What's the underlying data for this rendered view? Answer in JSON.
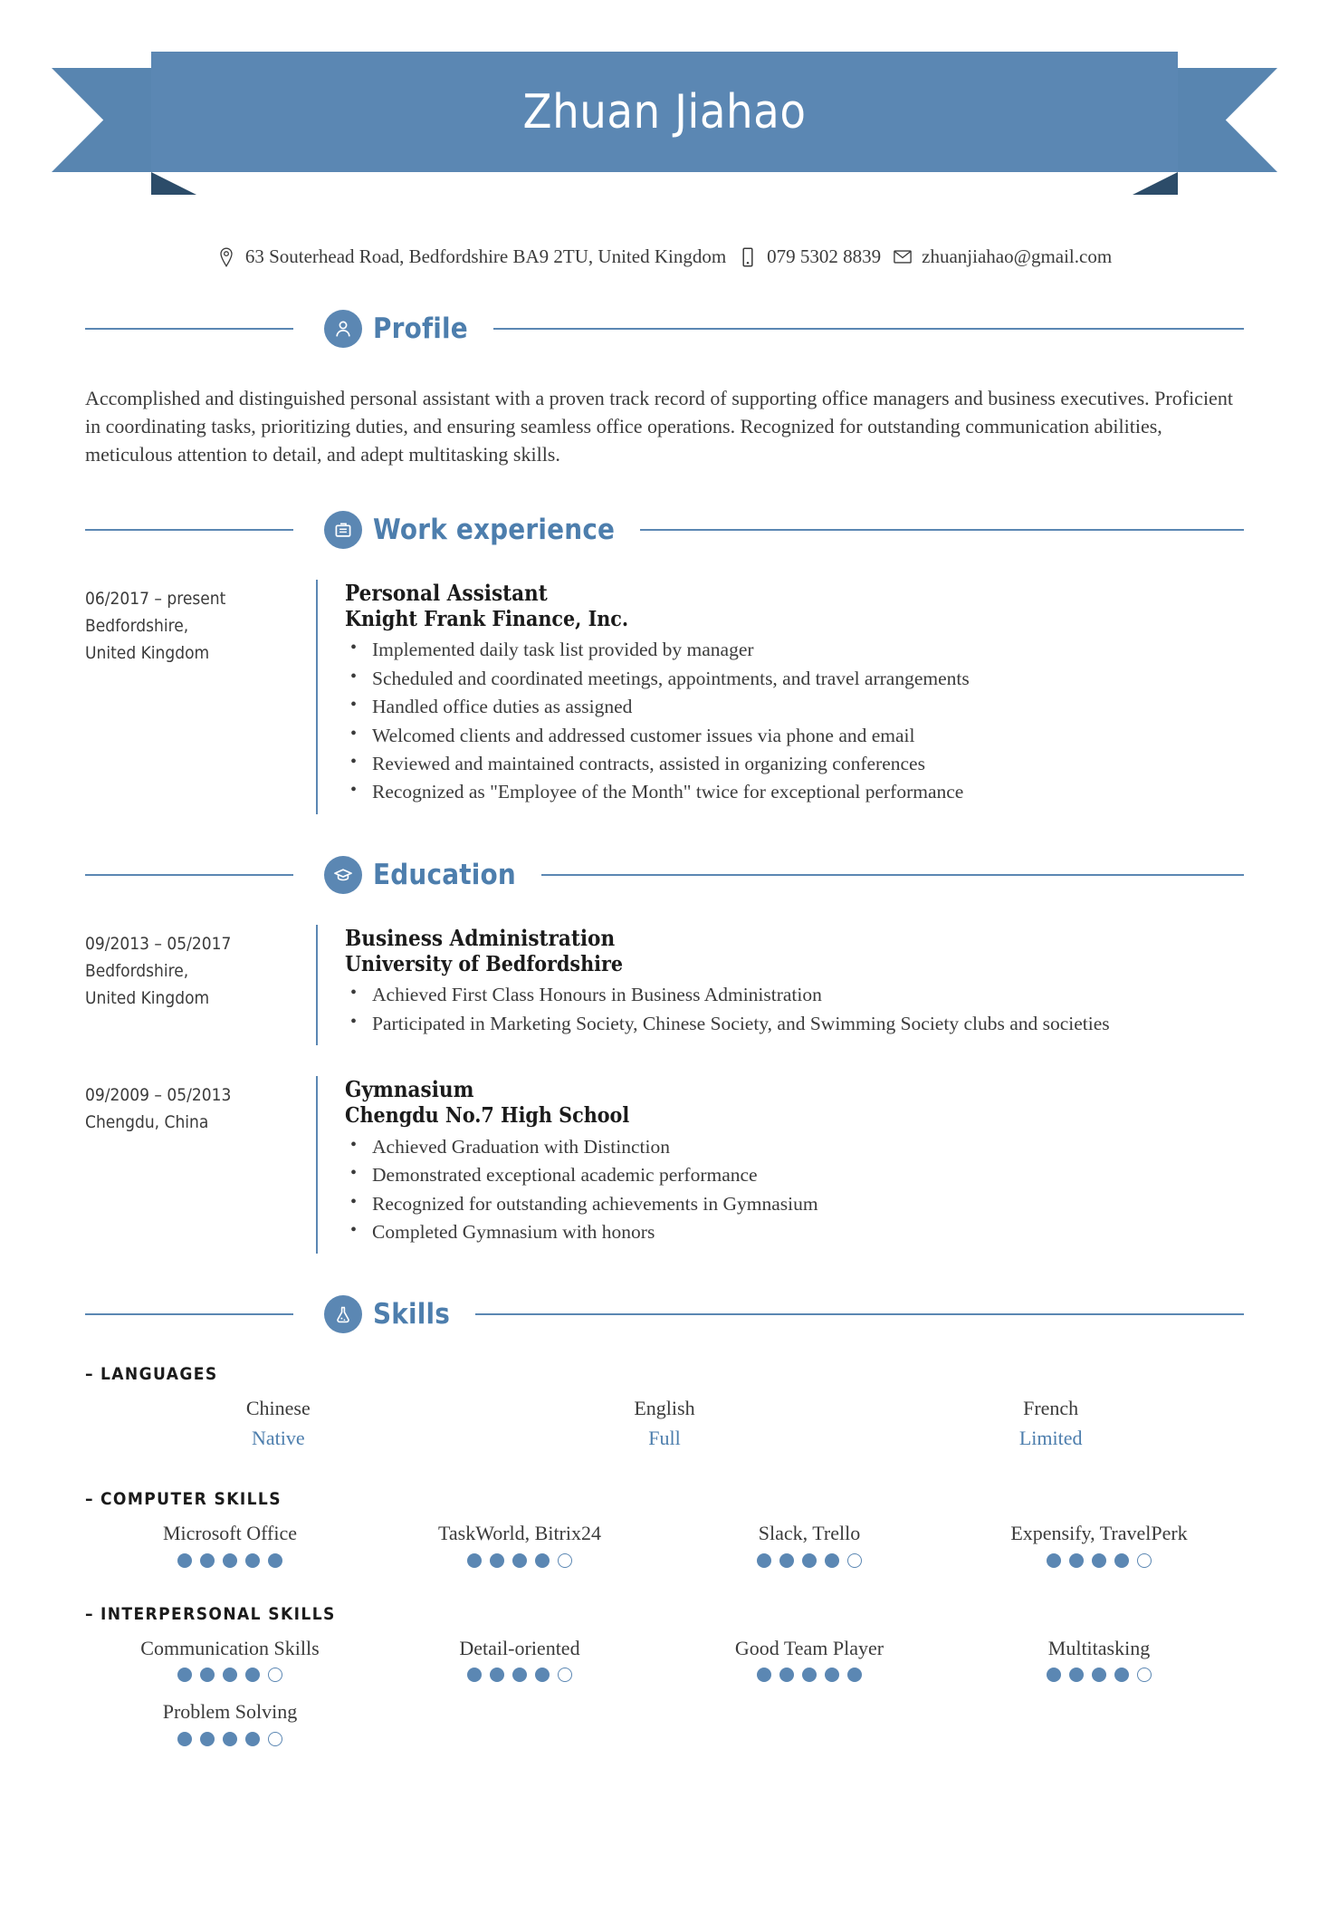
{
  "header": {
    "name": "Zhuan Jiahao",
    "accent_color": "#5b87b3",
    "ribbon_shadow_color": "#2c4c69"
  },
  "contact": {
    "address": "63 Souterhead Road, Bedfordshire BA9 2TU, United Kingdom",
    "address_icon": "location-pin-icon",
    "phone": "079 5302 8839",
    "phone_icon": "mobile-phone-icon",
    "email": "zhuanjiahao@gmail.com",
    "email_icon": "envelope-icon"
  },
  "sections": {
    "profile": {
      "title": "Profile",
      "icon": "person-icon",
      "text": "Accomplished and distinguished personal assistant with a proven track record of supporting office managers and business executives. Proficient in coordinating tasks, prioritizing duties, and ensuring seamless office operations. Recognized for outstanding communication abilities, meticulous attention to detail, and adept multitasking skills."
    },
    "work": {
      "title": "Work experience",
      "icon": "briefcase-icon",
      "entries": [
        {
          "dates": "06/2017 – present",
          "location_line1": "Bedfordshire,",
          "location_line2": "United Kingdom",
          "role": "Personal Assistant",
          "organization": "Knight Frank Finance, Inc.",
          "bullets": [
            "Implemented daily task list provided by manager",
            "Scheduled and coordinated meetings, appointments, and travel arrangements",
            "Handled office duties as assigned",
            "Welcomed clients and addressed customer issues via phone and email",
            "Reviewed and maintained contracts, assisted in organizing conferences",
            "Recognized as \"Employee of the Month\" twice for exceptional performance"
          ]
        }
      ]
    },
    "education": {
      "title": "Education",
      "icon": "graduation-cap-icon",
      "entries": [
        {
          "dates": "09/2013 – 05/2017",
          "location_line1": "Bedfordshire,",
          "location_line2": "United Kingdom",
          "role": "Business Administration",
          "organization": "University of Bedfordshire",
          "bullets": [
            "Achieved First Class Honours in Business Administration",
            "Participated in Marketing Society, Chinese Society, and Swimming Society clubs and societies"
          ]
        },
        {
          "dates": "09/2009 – 05/2013",
          "location_line1": "Chengdu, China",
          "location_line2": "",
          "role": "Gymnasium",
          "organization": "Chengdu No.7 High School",
          "bullets": [
            "Achieved Graduation with Distinction",
            "Demonstrated exceptional academic performance",
            "Recognized for outstanding achievements in Gymnasium",
            "Completed Gymnasium with honors"
          ]
        }
      ]
    },
    "skills": {
      "title": "Skills",
      "icon": "flask-icon",
      "groups": [
        {
          "label": "LANGUAGES",
          "columns": 3,
          "items": [
            {
              "name": "Chinese",
              "level": "Native"
            },
            {
              "name": "English",
              "level": "Full"
            },
            {
              "name": "French",
              "level": "Limited"
            }
          ]
        },
        {
          "label": "COMPUTER SKILLS",
          "columns": 4,
          "items": [
            {
              "name": "Microsoft Office",
              "rating": 5,
              "max": 5
            },
            {
              "name": "TaskWorld, Bitrix24",
              "rating": 4,
              "max": 5
            },
            {
              "name": "Slack, Trello",
              "rating": 4,
              "max": 5
            },
            {
              "name": "Expensify, TravelPerk",
              "rating": 4,
              "max": 5
            }
          ]
        },
        {
          "label": "INTERPERSONAL SKILLS",
          "columns": 4,
          "items": [
            {
              "name": "Communication Skills",
              "rating": 4,
              "max": 5
            },
            {
              "name": "Detail-oriented",
              "rating": 4,
              "max": 5
            },
            {
              "name": "Good Team Player",
              "rating": 5,
              "max": 5
            },
            {
              "name": "Multitasking",
              "rating": 4,
              "max": 5
            },
            {
              "name": "Problem Solving",
              "rating": 4,
              "max": 5
            }
          ]
        }
      ]
    }
  }
}
